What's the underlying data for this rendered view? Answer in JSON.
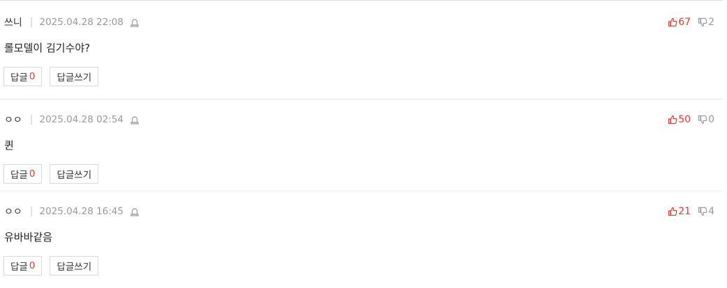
{
  "comments": [
    {
      "nick": "쓰니",
      "date": "2025.04.28 22:08",
      "upvotes": "67",
      "downvotes": "2",
      "text": "롤모델이 김기수야?",
      "reply_label": "답글",
      "reply_count": "0",
      "write_reply_label": "답글쓰기"
    },
    {
      "nick": "ㅇㅇ",
      "date": "2025.04.28 02:54",
      "upvotes": "50",
      "downvotes": "0",
      "text": "퀸",
      "reply_label": "답글",
      "reply_count": "0",
      "write_reply_label": "답글쓰기"
    },
    {
      "nick": "ㅇㅇ",
      "date": "2025.04.28 16:45",
      "upvotes": "21",
      "downvotes": "4",
      "text": "유바바같음",
      "reply_label": "답글",
      "reply_count": "0",
      "write_reply_label": "답글쓰기"
    }
  ],
  "icons": {
    "report": "report-siren-icon",
    "upvote": "thumbs-up-icon",
    "downvote": "thumbs-down-icon"
  },
  "colors": {
    "accent_red": "#e43b2c",
    "muted_gray": "#999999",
    "border": "#d9d9d9"
  }
}
